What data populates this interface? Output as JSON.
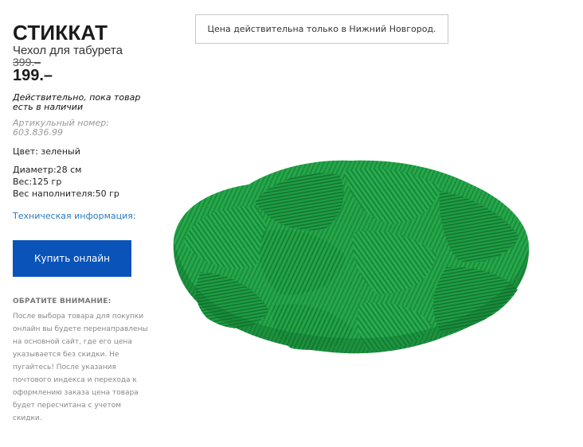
{
  "product": {
    "name": "СТИККАТ",
    "subtitle": "Чехол для табурета",
    "old_price": "399.–",
    "price": "199.–",
    "stock_note": "Действительно, пока товар есть в наличии",
    "article": "Артикульный номер: 603.836.99",
    "color": "Цвет: зеленый",
    "diameter": "Диаметр:28 см",
    "weight": "Вес:125 гр",
    "filling_weight": "Вес наполнителя:50 гр",
    "tech_info_link": "Техническая информация:",
    "image_icon": "green-corduroy-stool-cover",
    "brand_color": "#0a53b9"
  },
  "buy_button": {
    "label": "Купить онлайн"
  },
  "notice": {
    "heading": "ОБРАТИТЕ ВНИМАНИЕ:",
    "body": "После выбора товара для покупки онлайн вы будете перенаправлены на основной сайт, где его цена указывается без скидки. Не пугайтесь! После указания почтового индекса и перехода к оформлению заказа цена товара будет пересчитана с учетом скидки."
  },
  "city_notice": "Цена действительна только в Нижний Новгород."
}
